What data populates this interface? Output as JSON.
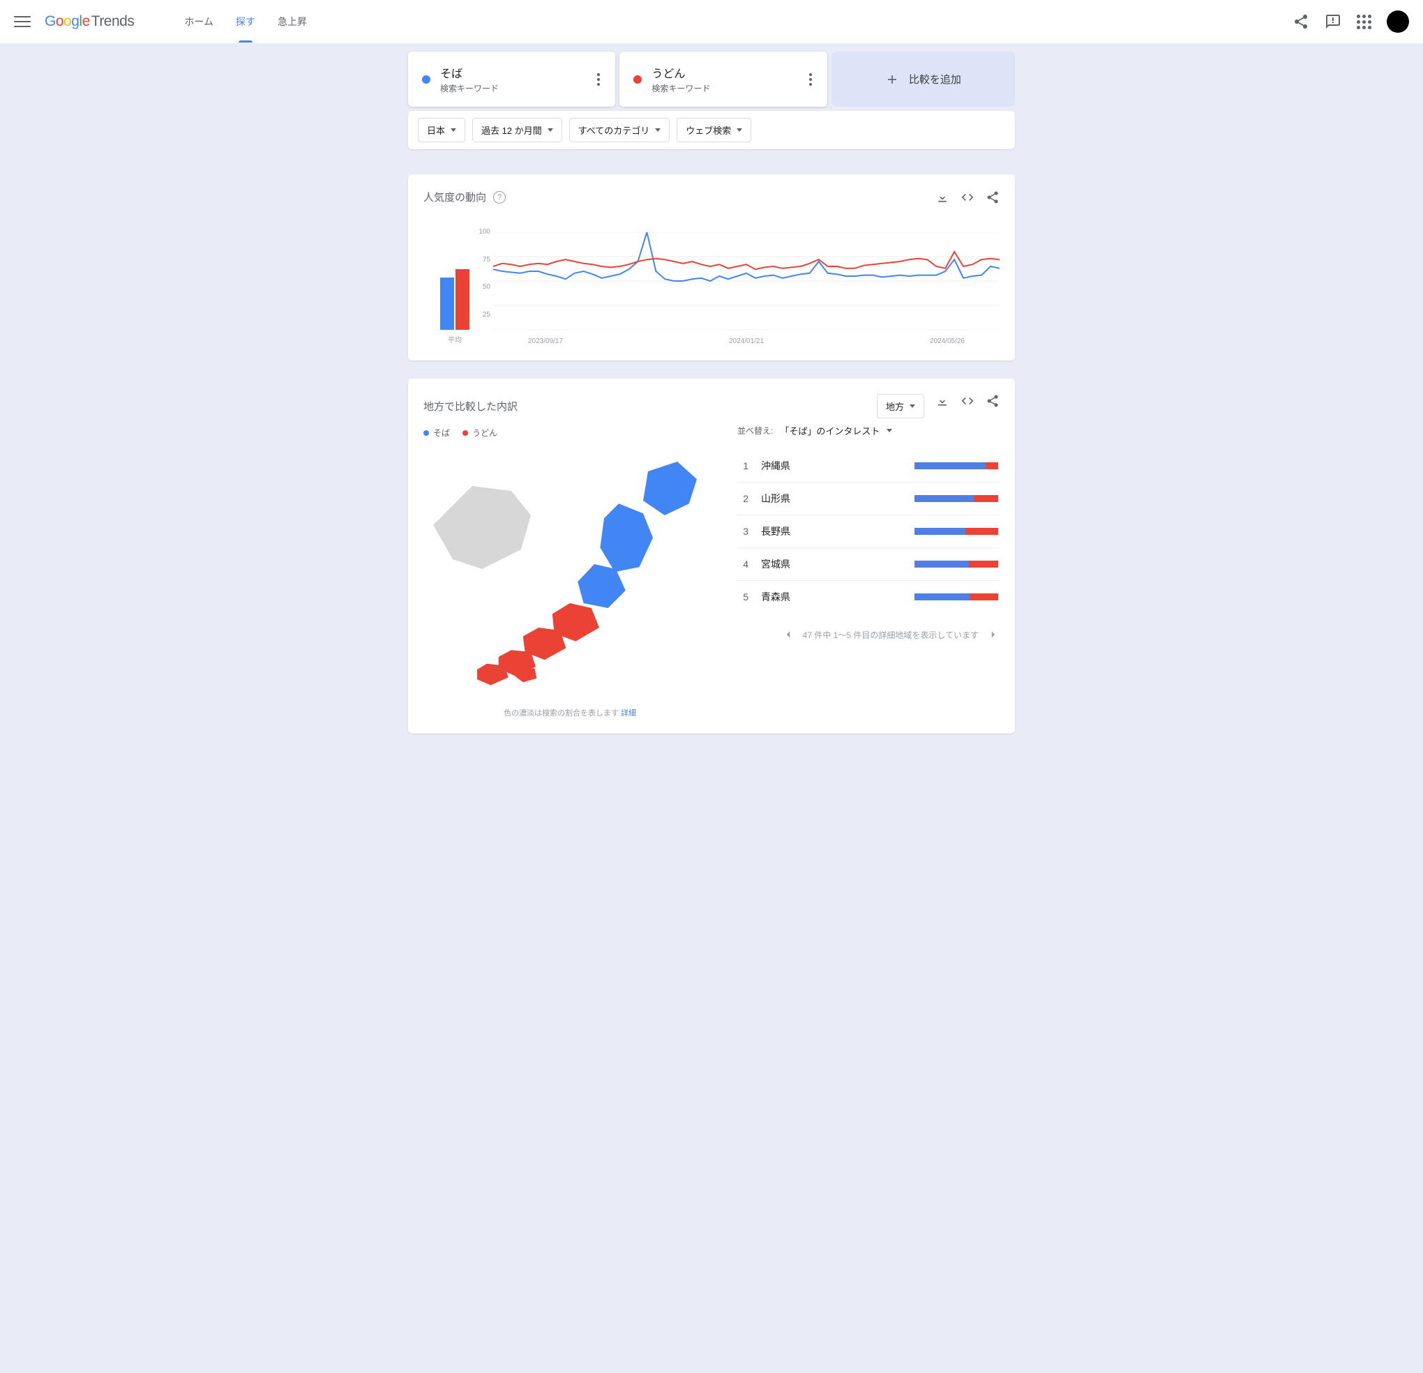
{
  "header": {
    "logo_trends": "Trends",
    "nav": {
      "home": "ホーム",
      "explore": "探す",
      "rising": "急上昇"
    }
  },
  "terms": [
    {
      "title": "そば",
      "subtitle": "検索キーワード",
      "color": "#4285f4"
    },
    {
      "title": "うどん",
      "subtitle": "検索キーワード",
      "color": "#ea4335"
    }
  ],
  "add_compare": "比較を追加",
  "filters": {
    "geo": "日本",
    "time": "過去 12 か月間",
    "category": "すべてのカテゴリ",
    "type": "ウェブ検索"
  },
  "trend_panel": {
    "title": "人気度の動向",
    "y_ticks": [
      "100",
      "75",
      "50",
      "25"
    ],
    "x_ticks": [
      "2023/09/17",
      "2024/01/21",
      "2024/05/26"
    ],
    "avg_label": "平均"
  },
  "chart_data": {
    "type": "line",
    "xlabel": "",
    "ylabel": "",
    "ylim": [
      0,
      100
    ],
    "x_ticks": [
      "2023/09/17",
      "2024/01/21",
      "2024/05/26"
    ],
    "avg": {
      "soba": 58,
      "udon": 67
    },
    "series": [
      {
        "name": "そば",
        "color": "#4285f4",
        "values": [
          62,
          60,
          59,
          58,
          60,
          60,
          57,
          55,
          52,
          58,
          60,
          57,
          53,
          55,
          57,
          62,
          70,
          100,
          60,
          52,
          50,
          50,
          52,
          53,
          50,
          55,
          52,
          55,
          58,
          53,
          55,
          56,
          53,
          55,
          57,
          58,
          70,
          58,
          57,
          55,
          55,
          56,
          56,
          54,
          55,
          56,
          55,
          56,
          56,
          56,
          60,
          72,
          53,
          55,
          56,
          65,
          63
        ]
      },
      {
        "name": "うどん",
        "color": "#ea4335",
        "values": [
          65,
          68,
          67,
          65,
          67,
          68,
          67,
          70,
          72,
          70,
          68,
          67,
          65,
          64,
          65,
          67,
          70,
          72,
          73,
          72,
          70,
          68,
          70,
          67,
          65,
          67,
          63,
          65,
          67,
          62,
          64,
          65,
          63,
          64,
          65,
          68,
          72,
          65,
          65,
          63,
          63,
          66,
          67,
          68,
          69,
          70,
          72,
          73,
          72,
          65,
          63,
          80,
          65,
          67,
          72,
          73,
          72
        ]
      }
    ]
  },
  "region_panel": {
    "title": "地方で比較した内訳",
    "scope": "地方",
    "legend": [
      "そば",
      "うどん"
    ],
    "sort_label": "並べ替え:",
    "sort_value": "「そば」のインタレスト",
    "map_note": "色の濃淡は検索の割合を表します ",
    "map_note_link": "詳細",
    "rows": [
      {
        "rank": 1,
        "name": "沖縄県",
        "soba_pct": 85
      },
      {
        "rank": 2,
        "name": "山形県",
        "soba_pct": 71
      },
      {
        "rank": 3,
        "name": "長野県",
        "soba_pct": 61
      },
      {
        "rank": 4,
        "name": "宮城県",
        "soba_pct": 65
      },
      {
        "rank": 5,
        "name": "青森県",
        "soba_pct": 66
      }
    ],
    "pager": "47 件中 1～5 件目の詳細地域を表示しています"
  }
}
